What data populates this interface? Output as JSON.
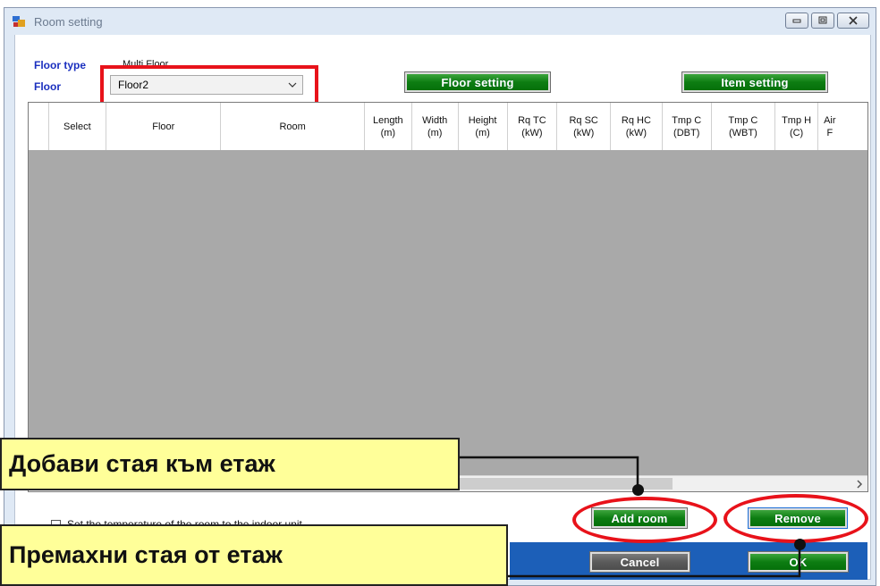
{
  "window": {
    "title": "Room setting"
  },
  "form": {
    "floor_type_label": "Floor type",
    "floor_type_value": "Multi Floor",
    "floor_label": "Floor",
    "floor_select_value": "Floor2"
  },
  "buttons": {
    "floor_setting": "Floor setting",
    "item_setting": "Item setting",
    "add_room": "Add room",
    "remove": "Remove",
    "cancel": "Cancel",
    "ok": "OK"
  },
  "grid": {
    "headers": [
      "Select",
      "Floor",
      "Room",
      "Length\n(m)",
      "Width\n(m)",
      "Height\n(m)",
      "Rq TC\n(kW)",
      "Rq SC\n(kW)",
      "Rq HC\n(kW)",
      "Tmp C\n(DBT)",
      "Tmp C\n(WBT)",
      "Tmp H\n(C)",
      "Air\nF"
    ]
  },
  "checkbox": {
    "label": "Set the temperature of the room to the indoor unit"
  },
  "callouts": {
    "add": "Добави стая към етаж",
    "remove": "Премахни стая от етаж"
  },
  "colors": {
    "highlight_red": "#e8121a",
    "callout_yellow": "#ffff99",
    "button_green": "#0d7d12",
    "grid_gray": "#a9a9a9",
    "label_blue": "#1a2fbf",
    "status_bar_blue": "#1c5fb8"
  }
}
